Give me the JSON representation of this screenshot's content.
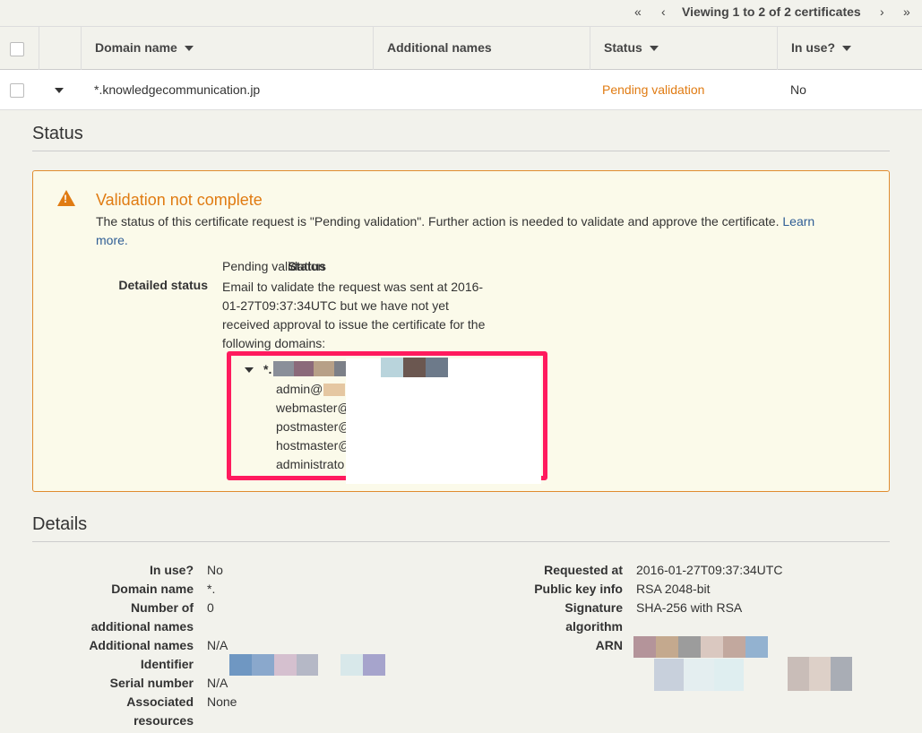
{
  "pager": {
    "first_icon": "double-chevron-left-icon",
    "prev_icon": "chevron-left-icon",
    "text": "Viewing 1 to 2 of 2 certificates",
    "next_icon": "chevron-right-icon",
    "last_icon": "double-chevron-right-icon"
  },
  "table": {
    "headers": [
      "Domain name",
      "Additional names",
      "Status",
      "In use?"
    ],
    "row": {
      "domain": "*.knowledgecommunication.jp",
      "additional": "",
      "status": "Pending validation",
      "in_use": "No"
    }
  },
  "status_section": {
    "title": "Status",
    "alert_title": "Validation not complete",
    "alert_text": "The status of this certificate request is \"Pending validation\". Further action is needed to validate and approve the certificate.",
    "learn_more": "Learn more.",
    "status_label": "Status",
    "status_value": "Pending validation",
    "detail_label": "Detailed status",
    "detail_lines": [
      "Email to validate the request was sent at 2016-",
      "01-27T09:37:34UTC but we have not yet",
      "received approval to issue the certificate for the",
      "following domains:"
    ],
    "domain_prefix": "*.",
    "emails": [
      "admin@",
      "webmaster@",
      "postmaster@",
      "hostmaster@",
      "administrato"
    ]
  },
  "details_section": {
    "title": "Details",
    "left": [
      {
        "label": "In use?",
        "value": "No"
      },
      {
        "label": "Domain name",
        "value": "*."
      },
      {
        "label": "Number of",
        "value": "0"
      },
      {
        "label": "additional names",
        "value": ""
      },
      {
        "label": "Additional names",
        "value": "N/A"
      },
      {
        "label": "Identifier",
        "value": ""
      },
      {
        "label": "Serial number",
        "value": "N/A"
      },
      {
        "label": "Associated",
        "value": "None"
      },
      {
        "label": "resources",
        "value": ""
      }
    ],
    "right": [
      {
        "label": "Requested at",
        "value": "2016-01-27T09:37:34UTC"
      },
      {
        "label": "Public key info",
        "value": "RSA 2048-bit"
      },
      {
        "label": "Signature",
        "value": "SHA-256 with RSA"
      },
      {
        "label": "algorithm",
        "value": ""
      },
      {
        "label": "ARN",
        "value": ""
      }
    ]
  },
  "colors": {
    "accent": "#e07b12",
    "link": "#2f5d95",
    "highlight_box": "#ff1a5e"
  }
}
